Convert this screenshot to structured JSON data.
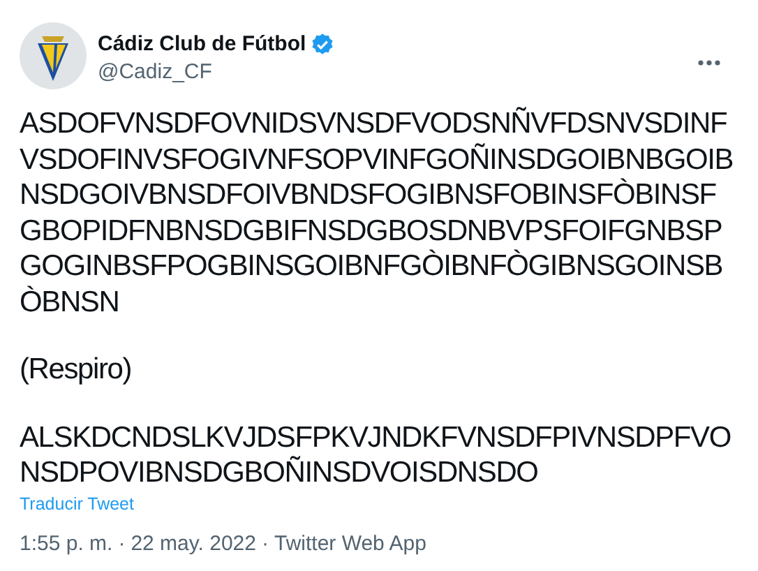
{
  "author": {
    "name": "Cádiz Club de Fútbol",
    "handle": "@Cadiz_CF",
    "verified": true
  },
  "tweet": {
    "paragraphs": [
      [
        "ASDOFVNSDFOVNIDSVNSDFVODSNÑVFDSNVSDINF",
        "VSDOFINVSFOGIVNFSOPVINFGOÑINSDGOIBNBGOIB",
        "NSDGOIVBNSDFOIVBNDSFOGIBNSFOBINSFÒBINSF",
        "GBOPIDFNBNSDGBIFNSDGBOSDNBVPSFOIFGNBSP",
        "GOGINBSFPOGBINSGOIBNFGÒIBNFÒGIBNSGOINSB",
        "ÒBNSN"
      ],
      [
        "(Respiro)"
      ],
      [
        "ALSKDCNDSLKVJDSFPKVJNDKFVNSDFPIVNSDPFVO",
        "NSDPOVIBNSDGBOÑINSDVOISDNSDO"
      ]
    ]
  },
  "translate_link": "Traducir Tweet",
  "meta": {
    "time": "1:55 p. m.",
    "separator": "·",
    "date": "22 may. 2022",
    "source": "Twitter Web App"
  }
}
